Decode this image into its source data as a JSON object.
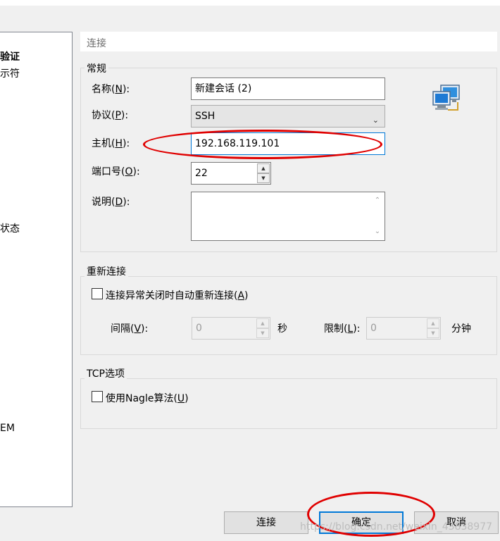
{
  "left_panel": {
    "items": [
      {
        "text": "验证",
        "bold": true
      },
      {
        "text": "示符",
        "bold": false
      },
      {
        "text": "状态",
        "bold": false
      },
      {
        "text": "EM",
        "bold": false
      }
    ]
  },
  "header": {
    "title": "连接"
  },
  "general": {
    "title": "常规",
    "name": {
      "label": "名称(",
      "mnemonic": "N",
      "suffix": "):",
      "value": "新建会话 (2)"
    },
    "protocol": {
      "label": "协议(",
      "mnemonic": "P",
      "suffix": "):",
      "value": "SSH"
    },
    "host": {
      "label": "主机(",
      "mnemonic": "H",
      "suffix": "):",
      "value": "192.168.119.101"
    },
    "port": {
      "label": "端口号(",
      "mnemonic": "O",
      "suffix": "):",
      "value": "22"
    },
    "description": {
      "label": "说明(",
      "mnemonic": "D",
      "suffix": "):",
      "value": ""
    }
  },
  "reconnect": {
    "title": "重新连接",
    "checkbox": {
      "label": "连接异常关闭时自动重新连接(",
      "mnemonic": "A",
      "suffix": ")",
      "checked": false
    },
    "interval": {
      "label": "间隔(",
      "mnemonic": "V",
      "suffix": "):",
      "value": "0",
      "unit": "秒"
    },
    "limit": {
      "label": "限制(",
      "mnemonic": "L",
      "suffix": "):",
      "value": "0",
      "unit": "分钟"
    }
  },
  "tcp": {
    "title": "TCP选项",
    "nagle": {
      "label": "使用Nagle算法(",
      "mnemonic": "U",
      "suffix": ")",
      "checked": false
    }
  },
  "buttons": {
    "connect": "连接",
    "ok": "确定",
    "cancel": "取消"
  },
  "watermark": "https://blog.csdn.net/weixin_43838977",
  "colors": {
    "annotation": "#e00000",
    "focus": "#0078d7"
  }
}
